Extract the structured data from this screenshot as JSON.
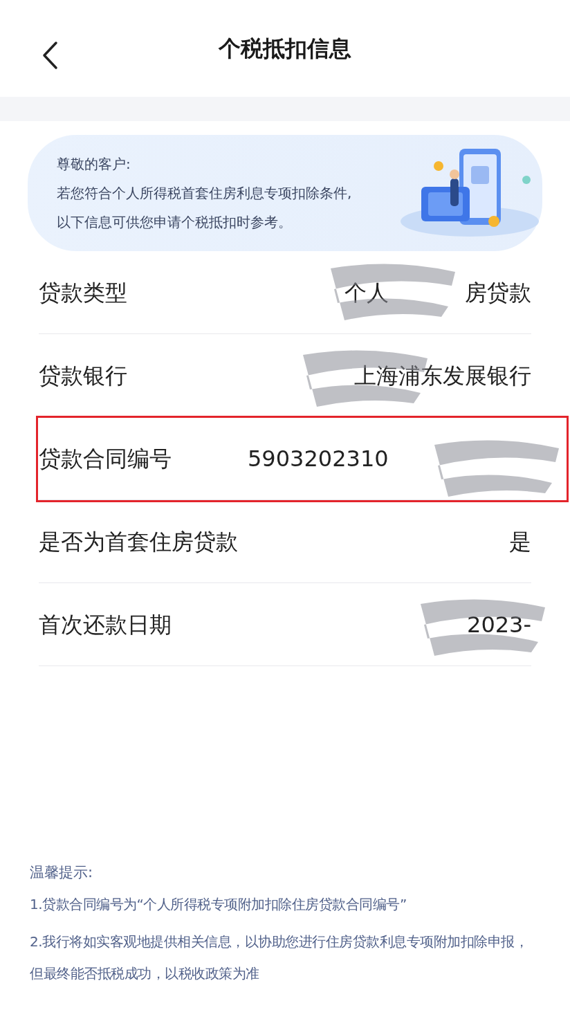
{
  "header": {
    "title": "个税抵扣信息"
  },
  "notice": {
    "lines": [
      "尊敬的客户:",
      "若您符合个人所得税首套住房利息专项扣除条件,",
      "以下信息可供您申请个税抵扣时参考。"
    ]
  },
  "rows": [
    {
      "label": "贷款类型",
      "value_parts": [
        "个人",
        "房贷款"
      ],
      "redacted": true,
      "highlighted": false
    },
    {
      "label": "贷款银行",
      "value_parts": [
        "上海浦东发展银行"
      ],
      "redacted": true,
      "highlighted": false
    },
    {
      "label": "贷款合同编号",
      "value_parts": [
        "5903202310"
      ],
      "redacted": true,
      "highlighted": true
    },
    {
      "label": "是否为首套住房贷款",
      "value_parts": [
        "是"
      ],
      "redacted": false,
      "highlighted": false
    },
    {
      "label": "首次还款日期",
      "value_parts": [
        "2023-"
      ],
      "redacted": true,
      "highlighted": false
    }
  ],
  "tips": {
    "title": "温馨提示:",
    "items": [
      "1.贷款合同编号为“个人所得税专项附加扣除住房贷款合同编号”",
      "2.我行将如实客观地提供相关信息，以协助您进行住房贷款利息专项附加扣除申报，但最终能否抵税成功，以税收政策为准"
    ]
  }
}
